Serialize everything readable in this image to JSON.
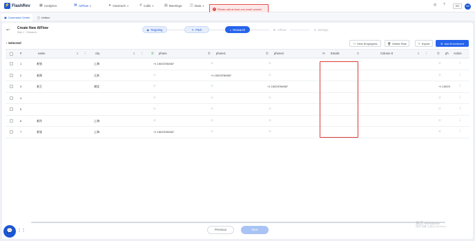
{
  "app": {
    "logo_text": "FlashRev",
    "logo_icon": "flashrev-logo-icon"
  },
  "nav": [
    {
      "label": "Analytics",
      "icon": "chart-icon"
    },
    {
      "label": "AIFlow",
      "icon": "flow-icon"
    },
    {
      "label": "Outreach",
      "icon": "send-icon"
    },
    {
      "label": "Calls",
      "icon": "phone-icon"
    },
    {
      "label": "Meetings",
      "icon": "calendar-icon"
    },
    {
      "label": "Data",
      "icon": "database-icon"
    }
  ],
  "error_banner": "Please add at least one email column!",
  "language": "EN",
  "avatar_initials": "HD",
  "tabs": [
    {
      "label": "Command Center"
    },
    {
      "label": "Unibox"
    }
  ],
  "page": {
    "title": "Create New AIFlow",
    "subtitle": "Step 1 · Research"
  },
  "steps": [
    {
      "label": "Targeting",
      "state": "done"
    },
    {
      "label": "Pitch",
      "state": "done"
    },
    {
      "label": "Research",
      "state": "current"
    },
    {
      "label": "AIFlow",
      "state": "todo"
    },
    {
      "label": "Settings",
      "state": "todo"
    }
  ],
  "toolbar": {
    "selected_label": "Selected",
    "view_employees": "View Employees",
    "delete_row": "Delete Row",
    "export": "Export",
    "add_enrichment": "Add Enrichment"
  },
  "table": {
    "columns": [
      "#",
      "name",
      "city",
      "phone",
      "phone1",
      "phone2",
      "Email1",
      "Column 8",
      "ph",
      "Action"
    ],
    "rows": [
      {
        "num": "1",
        "name": "老张",
        "city": "上海",
        "phone": "+1 15023784567",
        "phone1": "",
        "phone2": ""
      },
      {
        "num": "2",
        "name": "老周",
        "city": "江苏",
        "phone": "",
        "phone1": "+1 15023784567",
        "phone2": ""
      },
      {
        "num": "3",
        "name": "老王",
        "city": "湖北",
        "phone": "",
        "phone1": "",
        "phone2": "+1 15023784567"
      },
      {
        "num": "4",
        "name": "",
        "city": "",
        "phone": "",
        "phone1": "",
        "phone2": ""
      },
      {
        "num": "5",
        "name": "",
        "city": "",
        "phone": "",
        "phone1": "",
        "phone2": ""
      },
      {
        "num": "6",
        "name": "老孙",
        "city": "上海",
        "phone": "",
        "phone1": "",
        "phone2": ""
      },
      {
        "num": "7",
        "name": "老张",
        "city": "上海",
        "phone": "+1 15023784567",
        "phone1": "",
        "phone2": ""
      }
    ],
    "ph_row3": "+1 15023"
  },
  "footer": {
    "previous": "Previous",
    "next": "Next"
  },
  "watermark": {
    "line1": "激活 Windows",
    "line2": "转到\"设置\"以激活 Windows。"
  },
  "colors": {
    "accent": "#2563eb",
    "error": "#d93b3b"
  }
}
